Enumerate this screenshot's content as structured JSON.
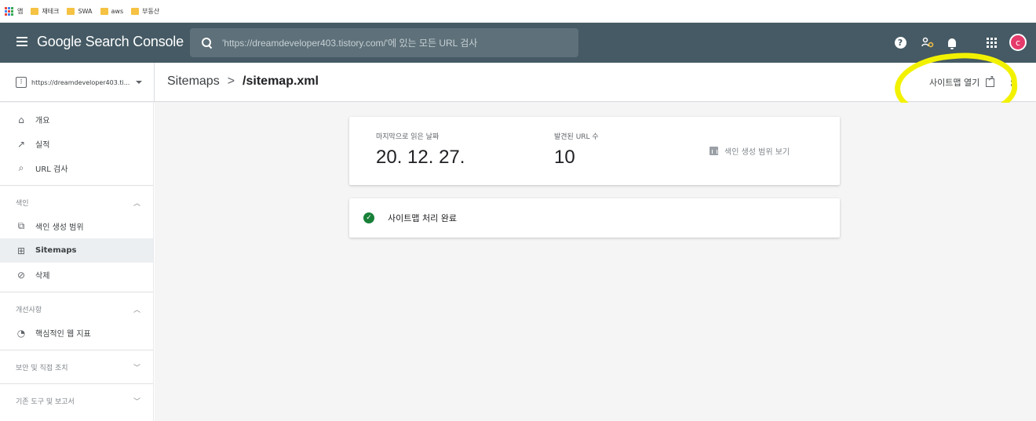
{
  "bookmarks": {
    "apps_label": "앱",
    "items": [
      {
        "label": "재테크"
      },
      {
        "label": "SWA"
      },
      {
        "label": "aws"
      },
      {
        "label": "부동산"
      }
    ]
  },
  "appbar": {
    "logo": "Google Search Console",
    "search_placeholder": "'https://dreamdeveloper403.tistory.com/'에 있는 모든 URL 검사",
    "help_icon_glyph": "?",
    "avatar_initial": "c",
    "avatar_color": "#e53a6b"
  },
  "subbar": {
    "property": "https://dreamdeveloper403.ti...",
    "breadcrumb_parent": "Sitemaps",
    "breadcrumb_sep": ">",
    "breadcrumb_current": "/sitemap.xml",
    "open_sitemap_label": "사이트맵 열기"
  },
  "sidebar": {
    "top_items": [
      {
        "label": "개요",
        "icon": "home-icon"
      },
      {
        "label": "실적",
        "icon": "trending-icon"
      },
      {
        "label": "URL 검사",
        "icon": "search-icon"
      }
    ],
    "index_section": {
      "title": "색인",
      "items": [
        {
          "label": "색인 생성 범위",
          "icon": "copy-icon"
        },
        {
          "label": "Sitemaps",
          "icon": "sitemap-icon"
        },
        {
          "label": "삭제",
          "icon": "hidden-icon"
        }
      ]
    },
    "enhancements_section": {
      "title": "개선사항",
      "items": [
        {
          "label": "핵심적인 웹 지표",
          "icon": "speed-icon"
        }
      ]
    },
    "security_section": {
      "title": "보안 및 직접 조치"
    },
    "legacy_section": {
      "title": "기존 도구 및 보고서"
    }
  },
  "main": {
    "last_read_label": "마지막으로 읽은 날짜",
    "last_read_value": "20. 12. 27.",
    "found_urls_label": "발견된 URL 수",
    "found_urls_value": "10",
    "coverage_link": "색인 생성 범위 보기",
    "status_text": "사이트맵 처리 완료",
    "status_color": "#188038"
  }
}
